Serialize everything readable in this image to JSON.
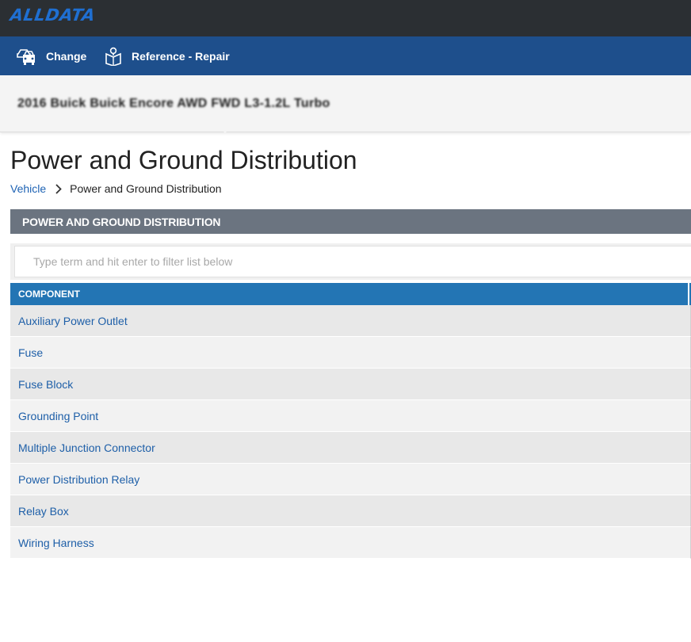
{
  "header": {
    "logo_text": "ALLDATA",
    "logo_color": "#1f6fd1",
    "background": "#2b2f33"
  },
  "nav": {
    "background": "#1e4f8c",
    "items": [
      {
        "label": "Change",
        "icon": "car-change-icon"
      },
      {
        "label": "Reference - Repair",
        "icon": "book-reference-icon"
      }
    ]
  },
  "vehicle": {
    "label": "2016 Buick Buick Encore AWD FWD L3-1.2L Turbo"
  },
  "page": {
    "title": "Power and Ground Distribution"
  },
  "breadcrumb": {
    "items": [
      "Vehicle",
      "Power and Ground Distribution"
    ],
    "separator_icon": "chevron-right-icon"
  },
  "section": {
    "title": "POWER AND GROUND DISTRIBUTION",
    "background": "#6b7480"
  },
  "filter": {
    "placeholder": "Type term and hit enter to filter list below",
    "value": ""
  },
  "table": {
    "header_color": "#2375b4",
    "columns": [
      "COMPONENT"
    ],
    "rows": [
      "Auxiliary Power Outlet",
      "Fuse",
      "Fuse Block",
      "Grounding Point",
      "Multiple Junction Connector",
      "Power Distribution Relay",
      "Relay Box",
      "Wiring Harness"
    ]
  }
}
